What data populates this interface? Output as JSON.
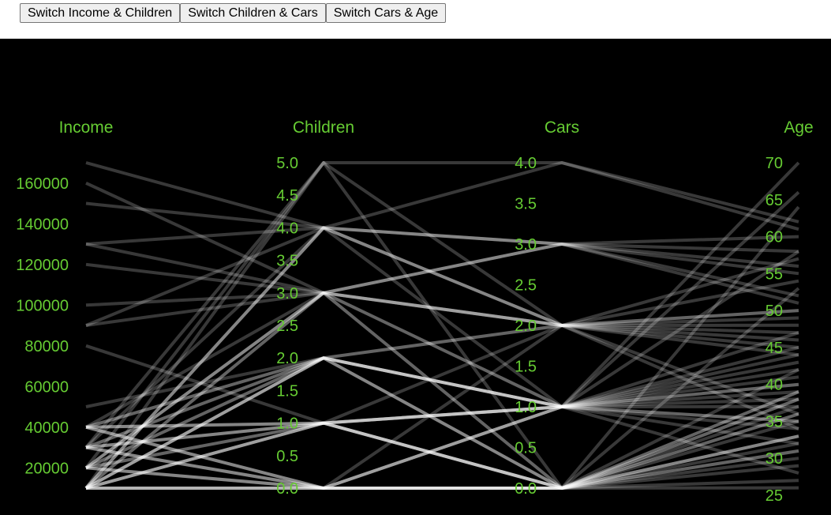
{
  "toolbar": {
    "buttons": [
      {
        "label": "Switch Income & Children"
      },
      {
        "label": "Switch Children & Cars"
      },
      {
        "label": "Switch Cars & Age"
      }
    ]
  },
  "colors": {
    "background": "#000000",
    "text": "#66cc33",
    "lines": "#ffffff"
  },
  "chart_data": {
    "type": "parallel-coordinates",
    "title": "",
    "grid": false,
    "axes": [
      {
        "name": "Income",
        "range": [
          10000,
          170000
        ],
        "ticks": [
          20000,
          40000,
          60000,
          80000,
          100000,
          120000,
          140000,
          160000
        ]
      },
      {
        "name": "Children",
        "range": [
          0,
          5
        ],
        "ticks": [
          "0.0",
          "0.5",
          "1.0",
          "1.5",
          "2.0",
          "2.5",
          "3.0",
          "3.5",
          "4.0",
          "4.5",
          "5.0"
        ]
      },
      {
        "name": "Cars",
        "range": [
          0,
          4
        ],
        "ticks": [
          "0.0",
          "0.5",
          "1.0",
          "1.5",
          "2.0",
          "2.5",
          "3.0",
          "3.5",
          "4.0"
        ]
      },
      {
        "name": "Age",
        "range": [
          25,
          70
        ],
        "ticks": [
          25,
          30,
          35,
          40,
          45,
          50,
          55,
          60,
          65,
          70
        ]
      }
    ],
    "records": [
      [
        170000,
        4,
        2,
        48
      ],
      [
        160000,
        3,
        3,
        52
      ],
      [
        150000,
        4,
        3,
        58
      ],
      [
        130000,
        3,
        2,
        45
      ],
      [
        130000,
        4,
        3,
        55
      ],
      [
        120000,
        3,
        2,
        50
      ],
      [
        100000,
        3,
        2,
        47
      ],
      [
        90000,
        4,
        4,
        61
      ],
      [
        90000,
        3,
        3,
        51
      ],
      [
        80000,
        1,
        0,
        38
      ],
      [
        50000,
        2,
        1,
        42
      ],
      [
        40000,
        1,
        1,
        35
      ],
      [
        40000,
        0,
        0,
        36
      ],
      [
        40000,
        2,
        1,
        40
      ],
      [
        40000,
        1,
        0,
        33
      ],
      [
        40000,
        0,
        1,
        37
      ],
      [
        30000,
        1,
        1,
        34
      ],
      [
        30000,
        0,
        0,
        32
      ],
      [
        30000,
        2,
        2,
        44
      ],
      [
        30000,
        1,
        0,
        36
      ],
      [
        30000,
        0,
        0,
        31
      ],
      [
        20000,
        2,
        1,
        43
      ],
      [
        20000,
        0,
        0,
        29
      ],
      [
        20000,
        1,
        1,
        38
      ],
      [
        20000,
        3,
        2,
        49
      ],
      [
        20000,
        0,
        1,
        35
      ],
      [
        10000,
        0,
        0,
        26
      ],
      [
        10000,
        1,
        0,
        30
      ],
      [
        10000,
        2,
        1,
        41
      ],
      [
        10000,
        4,
        2,
        46
      ],
      [
        10000,
        0,
        0,
        33
      ],
      [
        10000,
        5,
        4,
        62
      ],
      [
        10000,
        3,
        3,
        56
      ],
      [
        10000,
        1,
        1,
        39
      ],
      [
        10000,
        2,
        0,
        37
      ],
      [
        10000,
        0,
        2,
        34
      ],
      [
        10000,
        4,
        1,
        45
      ],
      [
        30000,
        5,
        0,
        53
      ],
      [
        20000,
        3,
        1,
        47
      ],
      [
        40000,
        2,
        0,
        39
      ],
      [
        10000,
        0,
        1,
        28
      ],
      [
        30000,
        4,
        2,
        54
      ],
      [
        20000,
        1,
        0,
        31
      ],
      [
        10000,
        2,
        2,
        50
      ],
      [
        40000,
        3,
        1,
        66
      ],
      [
        10000,
        1,
        1,
        70
      ],
      [
        20000,
        0,
        0,
        64
      ],
      [
        30000,
        2,
        1,
        58
      ],
      [
        10000,
        3,
        0,
        42
      ],
      [
        40000,
        1,
        2,
        36
      ],
      [
        20000,
        2,
        0,
        33
      ],
      [
        10000,
        4,
        3,
        60
      ],
      [
        30000,
        0,
        1,
        40
      ],
      [
        10000,
        1,
        0,
        35
      ],
      [
        20000,
        5,
        2,
        57
      ],
      [
        40000,
        0,
        0,
        38
      ],
      [
        10000,
        2,
        1,
        32
      ],
      [
        30000,
        1,
        1,
        44
      ],
      [
        20000,
        3,
        0,
        39
      ],
      [
        10000,
        0,
        0,
        27
      ]
    ]
  }
}
